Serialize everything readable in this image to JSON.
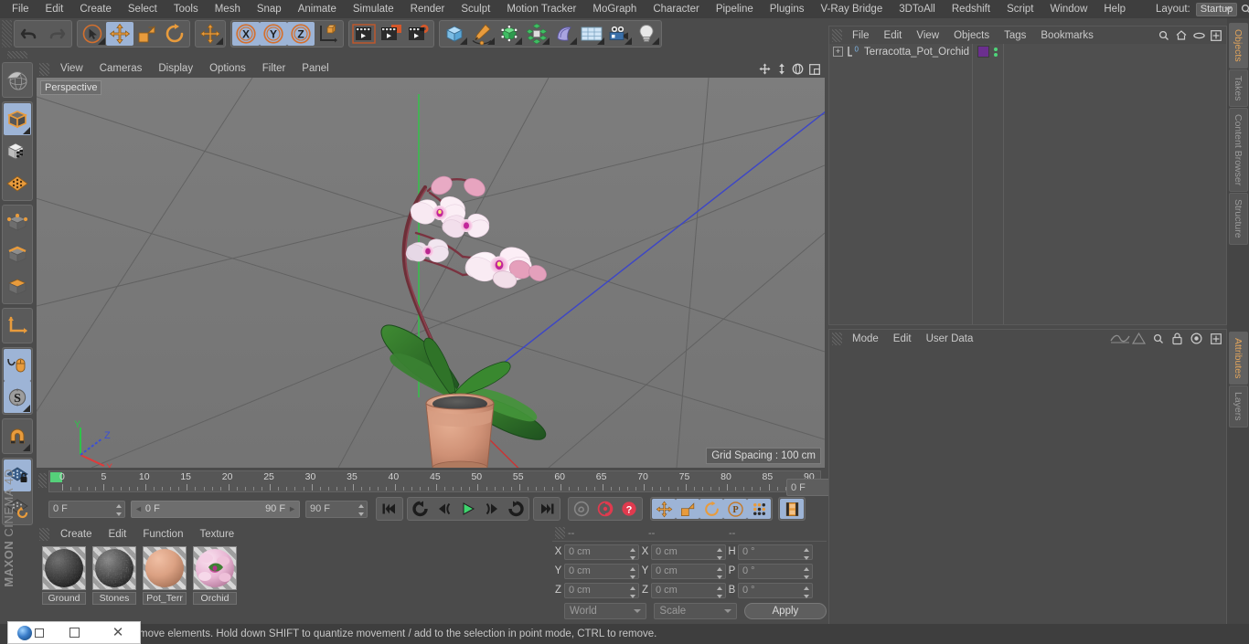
{
  "menubar": {
    "items": [
      "File",
      "Edit",
      "Create",
      "Select",
      "Tools",
      "Mesh",
      "Snap",
      "Animate",
      "Simulate",
      "Render",
      "Sculpt",
      "Motion Tracker",
      "MoGraph",
      "Character",
      "Pipeline",
      "Plugins",
      "V-Ray Bridge",
      "3DToAll",
      "Redshift",
      "Script",
      "Window",
      "Help"
    ],
    "layout_label": "Layout:",
    "layout_value": "Startup"
  },
  "toolbar": {
    "undo": "Undo",
    "redo": "Redo",
    "live_selection": "Live Selection",
    "move": "Move",
    "scale": "Scale",
    "rotate": "Rotate",
    "move_dup": "Move",
    "axis_x": "X",
    "axis_y": "Y",
    "axis_z": "Z",
    "world_object": "World/Object Axis",
    "render_view": "Render View",
    "render_region": "Render Region",
    "render_settings": "Render Settings",
    "cube": "Cube",
    "pen": "Pen / Spline",
    "subdivision": "Subdivision Surface",
    "mograph": "MoGraph Cloner",
    "deformer": "Bend Deformer",
    "floor": "Floor / Environment",
    "camera": "Camera",
    "light": "Light"
  },
  "lefttoolbar": {
    "items": [
      "make-editable",
      "texture-mode",
      "enable-axis",
      "point-mode",
      "edge-mode",
      "polygon-mode",
      "workplane",
      "mouse-viewport",
      "snap-settings",
      "magnet",
      "lock-workplane",
      "workplane-rotate"
    ]
  },
  "viewport": {
    "menus": [
      "View",
      "Cameras",
      "Display",
      "Options",
      "Filter",
      "Panel"
    ],
    "label": "Perspective",
    "grid_spacing": "Grid Spacing : 100 cm",
    "axis_x": "X",
    "axis_y": "Y",
    "axis_z": "Z",
    "nav_icons": [
      "pan-icon",
      "dolly-icon",
      "orbit-icon",
      "maximize-icon"
    ]
  },
  "timeline": {
    "ticks": [
      0,
      5,
      10,
      15,
      20,
      25,
      30,
      35,
      40,
      45,
      50,
      55,
      60,
      65,
      70,
      75,
      80,
      85,
      90
    ],
    "current_frame": 0,
    "range_start": 0,
    "range_end": 90
  },
  "transport": {
    "current_frame_field": "0 F",
    "range_start_label": "0 F",
    "range_end_label": "90 F",
    "end_frame_field": "90 F",
    "preview_frame_field": "0 F",
    "buttons": [
      "go-to-start",
      "play-reverse-loop",
      "step-back",
      "play",
      "step-forward",
      "loop",
      "go-to-end",
      "record-key",
      "autokey",
      "key-help",
      "move-key",
      "scale-key",
      "rotate-key",
      "parameter-key",
      "point-key",
      "timeline-toggle"
    ]
  },
  "materials": {
    "menus": [
      "Create",
      "Edit",
      "Function",
      "Texture"
    ],
    "items": [
      {
        "name": "Ground",
        "color": "#3a3a3a",
        "type": "noise-dark"
      },
      {
        "name": "Stones",
        "color": "#454545",
        "type": "noise-stone"
      },
      {
        "name": "Pot_Terr",
        "color": "#d9a286",
        "type": "solid"
      },
      {
        "name": "Orchid",
        "color": "#e4bcd2",
        "type": "orchid-texture"
      }
    ]
  },
  "coordinates": {
    "header_cols": [
      "--",
      "--",
      "--"
    ],
    "position": {
      "x_label": "X",
      "y_label": "Y",
      "z_label": "Z",
      "x": "0 cm",
      "y": "0 cm",
      "z": "0 cm"
    },
    "size": {
      "x_label": "X",
      "y_label": "Y",
      "z_label": "Z",
      "x": "0 cm",
      "y": "0 cm",
      "z": "0 cm"
    },
    "rotation": {
      "h_label": "H",
      "p_label": "P",
      "b_label": "B",
      "h": "0 °",
      "p": "0 °",
      "b": "0 °"
    },
    "coord_system": "World",
    "transform_mode": "Scale",
    "apply_label": "Apply"
  },
  "object_manager": {
    "menus": [
      "File",
      "Edit",
      "View",
      "Objects",
      "Tags",
      "Bookmarks"
    ],
    "icons": [
      "search-icon",
      "home-icon",
      "ellipse-icon",
      "plus-box-icon"
    ],
    "objects": [
      {
        "name": "Terracotta_Pot_Orchid",
        "layer": "0",
        "material_color": "#6b2f8e",
        "expandable": true
      }
    ]
  },
  "attribute_manager": {
    "menus": [
      "Mode",
      "Edit",
      "User Data"
    ],
    "icons": [
      "wave-icon",
      "triangle-icon",
      "search-icon",
      "lock-icon",
      "target-icon",
      "plus-box-icon"
    ]
  },
  "vtabs_right": {
    "top": [
      {
        "label": "Objects",
        "active": true
      },
      {
        "label": "Takes",
        "active": false
      },
      {
        "label": "Content Browser",
        "active": false
      },
      {
        "label": "Structure",
        "active": false
      }
    ],
    "bottom": [
      {
        "label": "Attributes",
        "active": true
      },
      {
        "label": "Layers",
        "active": false
      }
    ]
  },
  "statusbar": {
    "text": "move elements. Hold down SHIFT to quantize movement / add to the selection in point mode, CTRL to remove."
  },
  "taskbar": {
    "app_icon": "cinema4d-icon",
    "restore_icon": "restore-window-icon",
    "maximize_icon": "maximize-window-icon",
    "close_icon": "close-window-icon"
  },
  "branding": {
    "line1": "MAXON",
    "line2": "CINEMA 4D"
  },
  "colors": {
    "accent_orange": "#e89b3c",
    "selected_blue": "#9db4d6",
    "panel_bg": "#4b4b4b",
    "viewport_bg": "#787878",
    "tab_active_text": "#e0a45c"
  }
}
